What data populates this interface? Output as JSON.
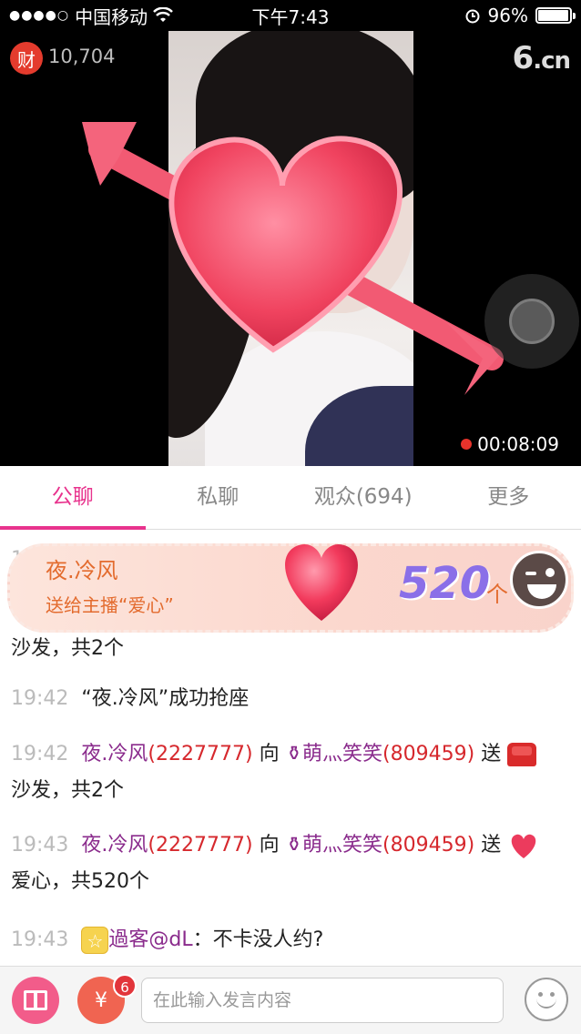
{
  "status_bar": {
    "signal": "●●●●○",
    "carrier": "中国移动",
    "time": "下午7:43",
    "battery": "96%",
    "battery_level": 0.96
  },
  "live": {
    "coin_icon_text": "财",
    "coin_count": "10,704",
    "logo_main": "6",
    "logo_suffix": ".cn",
    "timer": "00:08:09"
  },
  "tabs": [
    {
      "label": "公聊",
      "active": true
    },
    {
      "label": "私聊",
      "active": false
    },
    {
      "label": "观众(694)",
      "active": false
    },
    {
      "label": "更多",
      "active": false
    }
  ],
  "gift_banner": {
    "sender": "夜.冷风",
    "description": "送给主播“爱心”",
    "count": "520",
    "unit": "个"
  },
  "chat": [
    {
      "partial_time": "1",
      "continuation": "沙发，共2个"
    },
    {
      "time": "19:42",
      "text": "“夜.冷风”成功抢座"
    },
    {
      "time": "19:42",
      "user": "夜.冷风",
      "uid": "(2227777)",
      "verb": "向",
      "target": "萌灬笑笑",
      "target_uid": "(809459)",
      "send": "送",
      "tail": "沙发，共2个"
    },
    {
      "time": "19:43",
      "user": "夜.冷风",
      "uid": "(2227777)",
      "verb": "向",
      "target": "萌灬笑笑",
      "target_uid": "(809459)",
      "send": "送",
      "tail": "爱心，共520个"
    },
    {
      "time": "19:43",
      "user": "過客@dL",
      "text": "：不卡没人约?"
    }
  ],
  "bottom_bar": {
    "redpacket_icon_text": "¥",
    "redpacket_badge": "6",
    "input_placeholder": "在此输入发言内容"
  },
  "colors": {
    "accent": "#e8338d",
    "username": "#8a2b8c",
    "uid": "#d6282d",
    "gift_text": "#e36b2e"
  }
}
